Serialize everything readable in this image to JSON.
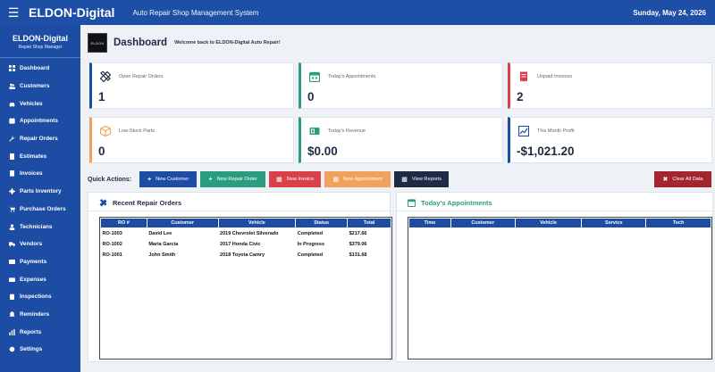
{
  "topbar": {
    "brand": "ELDON-Digital",
    "subtitle": "Auto Repair Shop Management System",
    "date": "Sunday, May 24, 2026",
    "menu_icon": "hamburger-icon"
  },
  "sidebar": {
    "title": "ELDON-Digital",
    "subtitle": "Repair Shop Manager",
    "items": [
      {
        "label": "Dashboard",
        "icon": "dashboard-icon"
      },
      {
        "label": "Customers",
        "icon": "users-icon"
      },
      {
        "label": "Vehicles",
        "icon": "car-icon"
      },
      {
        "label": "Appointments",
        "icon": "calendar-icon"
      },
      {
        "label": "Repair Orders",
        "icon": "wrench-icon"
      },
      {
        "label": "Estimates",
        "icon": "calculator-icon"
      },
      {
        "label": "Invoices",
        "icon": "invoice-icon"
      },
      {
        "label": "Parts Inventory",
        "icon": "gear-icon"
      },
      {
        "label": "Purchase Orders",
        "icon": "cart-icon"
      },
      {
        "label": "Technicians",
        "icon": "technician-icon"
      },
      {
        "label": "Vendors",
        "icon": "truck-icon"
      },
      {
        "label": "Payments",
        "icon": "credit-card-icon"
      },
      {
        "label": "Expenses",
        "icon": "receipt-icon"
      },
      {
        "label": "Inspections",
        "icon": "clipboard-icon"
      },
      {
        "label": "Reminders",
        "icon": "bell-icon"
      },
      {
        "label": "Reports",
        "icon": "chart-icon"
      },
      {
        "label": "Settings",
        "icon": "settings-icon"
      }
    ]
  },
  "header": {
    "logo_text": "ELDON",
    "title": "Dashboard",
    "welcome": "Welcome back to ELDON-Digital Auto Repair!"
  },
  "cards": [
    {
      "label": "Open Repair Orders",
      "value": "1",
      "icon": "tools-icon",
      "color": "#1c4ca4"
    },
    {
      "label": "Today's Appointments",
      "value": "0",
      "icon": "calendar-icon",
      "color": "#2a9d7f"
    },
    {
      "label": "Unpaid Invoices",
      "value": "2",
      "icon": "invoice-icon",
      "color": "#d9404a"
    },
    {
      "label": "Low-Stock Parts",
      "value": "0",
      "icon": "box-icon",
      "color": "#f0a25c"
    },
    {
      "label": "Today's Revenue",
      "value": "$0.00",
      "icon": "money-icon",
      "color": "#2a9d7f"
    },
    {
      "label": "This Month Profit",
      "value": "-$1,021.20",
      "icon": "chart-icon",
      "color": "#1c4ca4"
    }
  ],
  "quick_actions": {
    "label": "Quick Actions:",
    "buttons": [
      {
        "label": "New Customer",
        "icon": "plus-icon",
        "color": "#1c4ca4"
      },
      {
        "label": "New Repair Order",
        "icon": "plus-icon",
        "color": "#2a9d7f"
      },
      {
        "label": "New Invoice",
        "icon": "invoice-icon",
        "color": "#d9404a"
      },
      {
        "label": "New Appointment",
        "icon": "calendar-icon",
        "color": "#f0a25c"
      },
      {
        "label": "View Reports",
        "icon": "chart-icon",
        "color": "#1f2a44"
      }
    ],
    "clear": {
      "label": "Clear All Data",
      "icon": "trash-icon",
      "color": "#a3262f"
    }
  },
  "repair_orders": {
    "title": "Recent Repair Orders",
    "columns": [
      "RO #",
      "Customer",
      "Vehicle",
      "Status",
      "Total"
    ],
    "rows": [
      [
        "RO-1003",
        "David Lee",
        "2019 Chevrolet Silverado",
        "Completed",
        "$217.66"
      ],
      [
        "RO-1002",
        "Maria Garcia",
        "2017 Honda Civic",
        "In Progress",
        "$379.06"
      ],
      [
        "RO-1001",
        "John Smith",
        "2018 Toyota Camry",
        "Completed",
        "$131.68"
      ]
    ]
  },
  "appointments": {
    "title": "Today's Appointments",
    "columns": [
      "Time",
      "Customer",
      "Vehicle",
      "Service",
      "Tech"
    ],
    "rows": []
  }
}
